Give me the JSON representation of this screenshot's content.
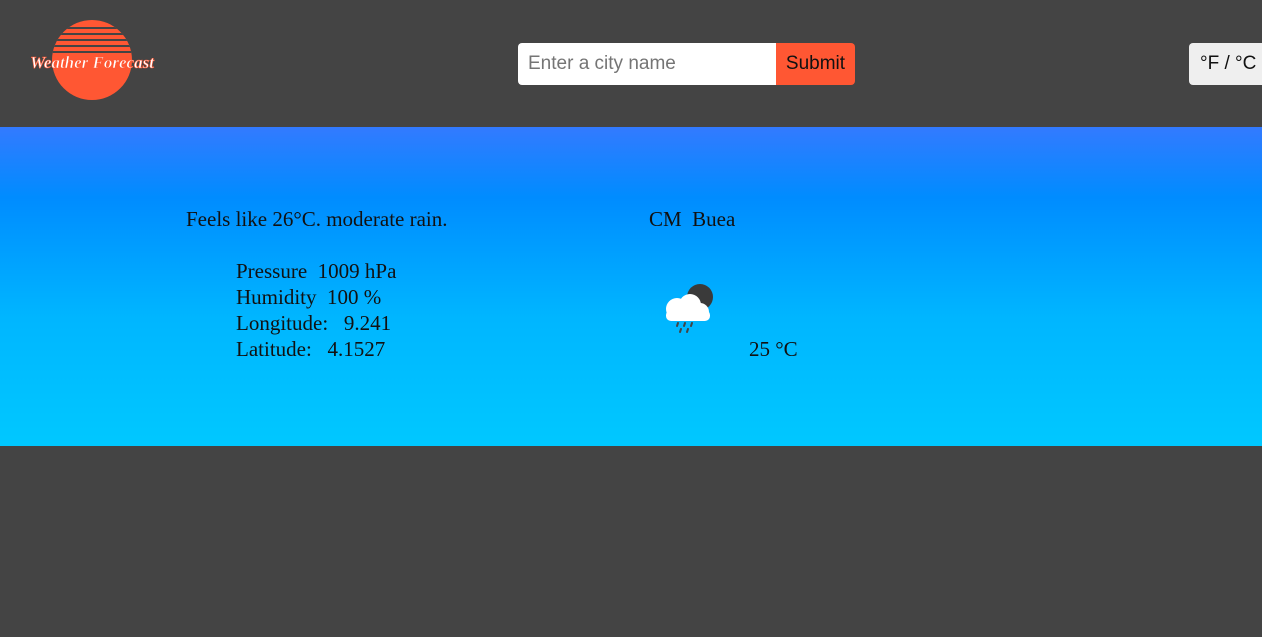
{
  "header": {
    "logo_text": "Weather Forecast",
    "search": {
      "placeholder": "Enter a city name",
      "value": ""
    },
    "submit_label": "Submit",
    "unit_toggle_label": "°F / °C"
  },
  "weather": {
    "feels_like": "Feels like 26°C. moderate rain.",
    "details": {
      "pressure": "Pressure  1009 hPa",
      "humidity": "Humidity  100 %",
      "longitude": "Longitude:   9.241",
      "latitude": "Latitude:   4.1527"
    },
    "location": "CM  Buea",
    "icon": "rain-cloud-night-icon",
    "temperature": "25 °C"
  },
  "colors": {
    "background": "#444444",
    "accent": "#ff5733",
    "panel_top": "#337aff",
    "panel_bottom": "#00c8ff"
  }
}
